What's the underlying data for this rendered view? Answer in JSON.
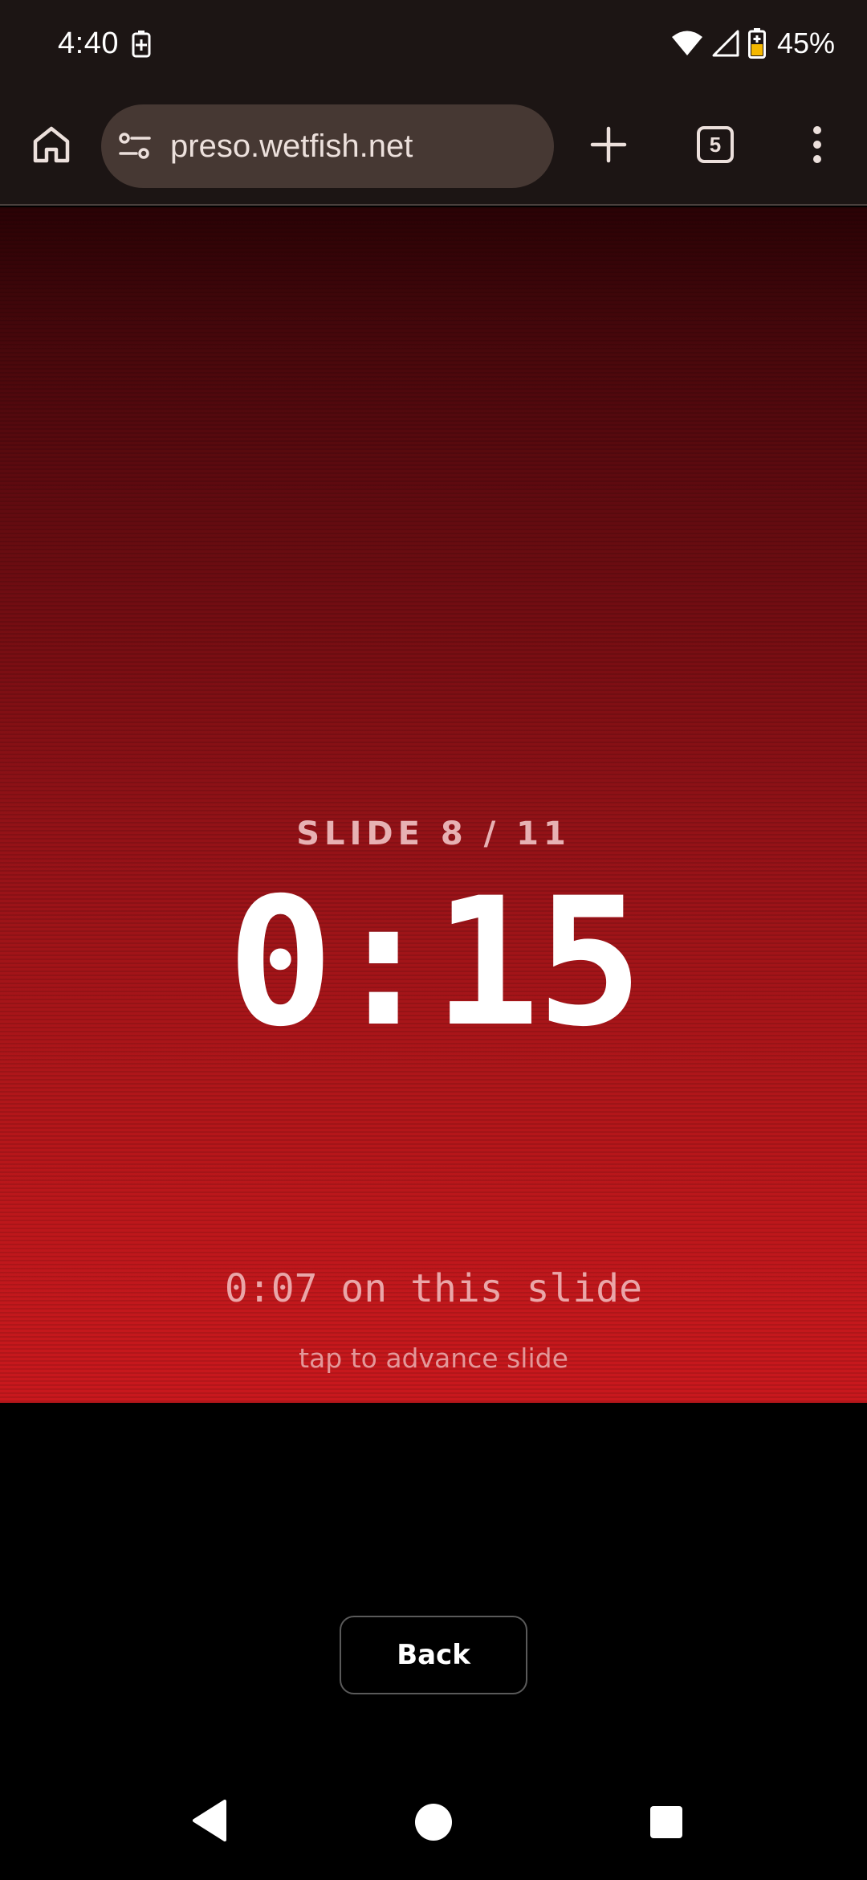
{
  "status_bar": {
    "time": "4:40",
    "battery_percent": "45%",
    "icons": [
      "battery-saver-icon",
      "wifi-icon",
      "cell-signal-icon",
      "battery-icon"
    ]
  },
  "browser": {
    "url": "preso.wetfish.net",
    "tab_count": "5",
    "icons": [
      "home-icon",
      "site-settings-icon",
      "plus-icon",
      "tab-switcher-icon",
      "more-vert-icon"
    ]
  },
  "presentation": {
    "slide_label": "SLIDE 8 / 11",
    "total_time": "0:15",
    "slide_time": "0:07 on this slide",
    "hint": "tap to advance slide",
    "colors": {
      "gradient_top": "#2a0205",
      "gradient_bottom": "#c9181d",
      "timer_text": "#ffffff"
    }
  },
  "actions": {
    "back_label": "Back"
  },
  "nav_bar": {
    "icons": [
      "nav-back-icon",
      "nav-home-icon",
      "nav-recents-icon"
    ]
  }
}
